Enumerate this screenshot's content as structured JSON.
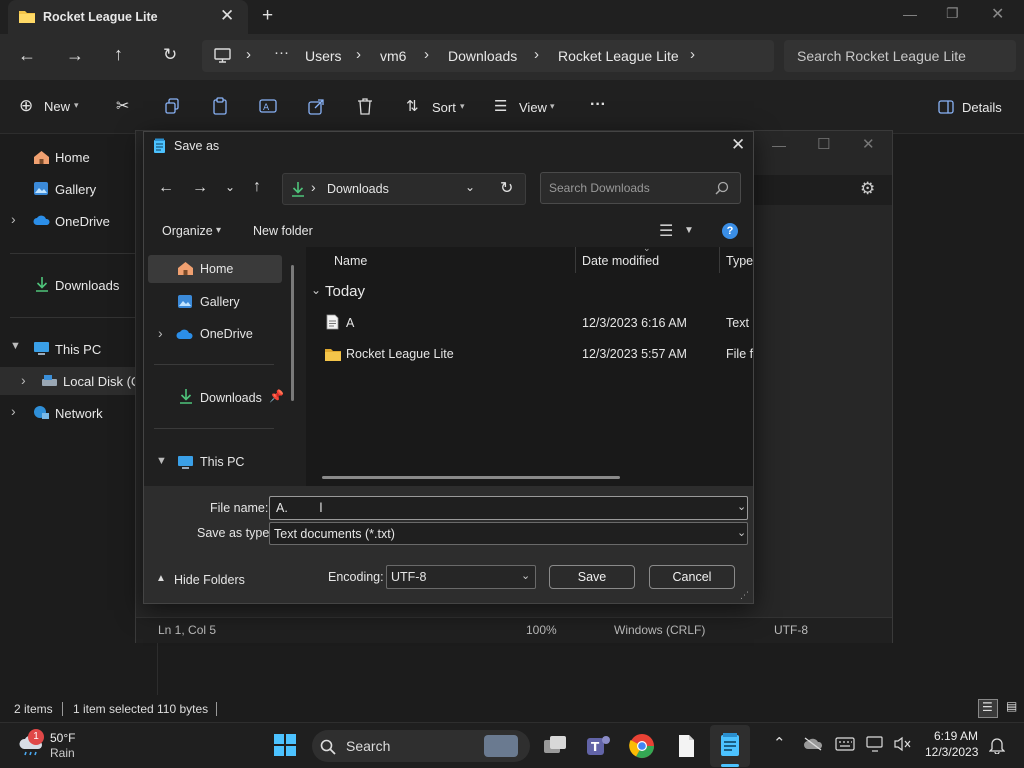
{
  "explorer": {
    "tab_title": "Rocket League Lite",
    "breadcrumb": [
      "Users",
      "vm6",
      "Downloads",
      "Rocket League Lite"
    ],
    "search_placeholder": "Search Rocket League Lite",
    "commands": {
      "new": "New",
      "sort": "Sort",
      "view": "View",
      "details": "Details"
    },
    "nav": [
      "Home",
      "Gallery",
      "OneDrive",
      "Downloads",
      "This PC",
      "Local Disk (C:",
      "Network"
    ],
    "status": {
      "items": "2 items",
      "selected": "1 item selected",
      "size": "110 bytes"
    }
  },
  "notepad": {
    "status": {
      "position": "Ln 1, Col 5",
      "zoom": "100%",
      "eol": "Windows (CRLF)",
      "encoding": "UTF-8"
    }
  },
  "dialog": {
    "title": "Save as",
    "path": "Downloads",
    "search_placeholder": "Search Downloads",
    "organize": "Organize",
    "new_folder": "New folder",
    "nav": [
      "Home",
      "Gallery",
      "OneDrive",
      "Downloads",
      "This PC"
    ],
    "columns": {
      "name": "Name",
      "date": "Date modified",
      "type": "Type"
    },
    "group": "Today",
    "files": [
      {
        "name": "A",
        "date": "12/3/2023 6:16 AM",
        "type": "Text D"
      },
      {
        "name": "Rocket League Lite",
        "date": "12/3/2023 5:57 AM",
        "type": "File fo"
      }
    ],
    "file_name_label": "File name:",
    "file_name_value": "A.",
    "save_type_label": "Save as type:",
    "save_type_value": "Text documents (*.txt)",
    "hide_folders": "Hide Folders",
    "encoding_label": "Encoding:",
    "encoding_value": "UTF-8",
    "save": "Save",
    "cancel": "Cancel"
  },
  "taskbar": {
    "weather": {
      "temp": "50°F",
      "cond": "Rain",
      "badge": "1"
    },
    "search": "Search",
    "time": "6:19 AM",
    "date": "12/3/2023"
  },
  "colors": {
    "accent": "#4cc2ff",
    "folder": "#f4c54a",
    "download": "#4ec47a"
  }
}
